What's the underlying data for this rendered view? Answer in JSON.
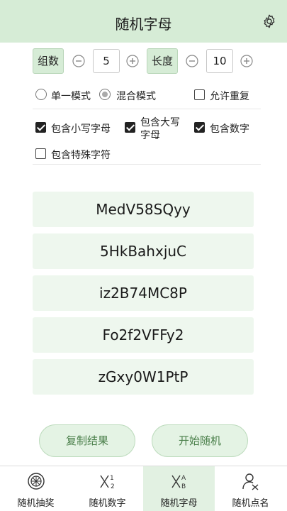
{
  "header": {
    "title": "随机字母",
    "settings_icon": "gear-icon"
  },
  "controls": {
    "groups_label": "组数",
    "groups_value": "5",
    "length_label": "长度",
    "length_value": "10"
  },
  "options": {
    "single_mode": "单一模式",
    "mixed_mode": "混合模式",
    "selected_mode": "mixed",
    "allow_repeat": "允许重复",
    "allow_repeat_checked": false,
    "lowercase": "包含小写字母",
    "lowercase_checked": true,
    "uppercase_line1": "包含大写",
    "uppercase_line2": "字母",
    "uppercase_checked": true,
    "digits": "包含数字",
    "digits_checked": true,
    "special": "包含特殊字符",
    "special_checked": false
  },
  "results": [
    "MedV58SQyy",
    "5HkBahxjuC",
    "iz2B74MC8P",
    "Fo2f2VFFy2",
    "zGxy0W1PtP"
  ],
  "actions": {
    "copy": "复制结果",
    "start": "开始随机"
  },
  "tabs": [
    {
      "label": "随机抽奖",
      "icon": "wheel-icon"
    },
    {
      "label": "随机数字",
      "icon": "numbers-icon"
    },
    {
      "label": "随机字母",
      "icon": "letters-icon"
    },
    {
      "label": "随机点名",
      "icon": "person-icon"
    }
  ],
  "colors": {
    "accent_bg": "#d6ecd6",
    "result_bg": "#eef7ee",
    "button_text": "#4a7f4a"
  }
}
